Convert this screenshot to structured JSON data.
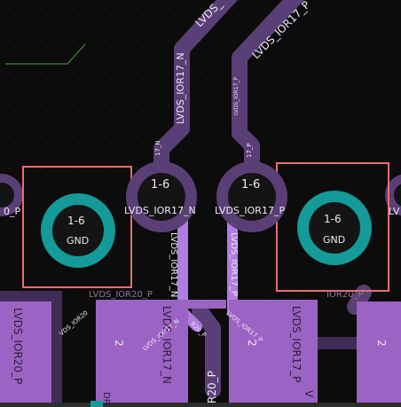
{
  "colors": {
    "background": "#0c0c0c",
    "track_dark": "#5a3f76",
    "track_light": "#b07de0",
    "pad_smd": "#9b63c4",
    "pad_smd_dark": "#412c55",
    "via_ring": "#149a98",
    "via_hole": "#141414",
    "courtyard": "#e96e74",
    "board_edge": "#3f8a35"
  },
  "icons": [
    "via-icon",
    "pad-icon"
  ],
  "pcb": {
    "top_net_left": "LVDS_",
    "top_net_right": "LVDS_IOR17_P",
    "trace_vertical_n": "LVDS_IOR17_N",
    "trace_vertical_p": "LVDS_IOR17_P",
    "small_n": "17_N",
    "small_p": "17_P",
    "via_left": {
      "layers": "1-6",
      "net": "LVDS_IOR17_N"
    },
    "via_right": {
      "layers": "1-6",
      "net": "LVDS_IOR17_P"
    },
    "gnd_left": {
      "layers": "1-6",
      "net": "GND"
    },
    "gnd_right": {
      "layers": "1-6",
      "net": "GND"
    },
    "left_edge_label": "0_P",
    "right_edge_label": "LV",
    "lower_track_n": "LVDS_IOR17_N",
    "lower_track_p": "LVDS_IOR17_P",
    "pad_labels": {
      "pad1_net": "LVDS_IOR20_P",
      "pad2_number": "2",
      "pad2_net": "LVDS_IOR17_N",
      "pad3_number": "2",
      "pad3_net": "LVDS_IOR17_P",
      "pad4_number": "2"
    },
    "ior20_mid": "LVDS_IOR20_P",
    "ior20_right": "IOR20_P",
    "small_ior20_left": "VDS_IOR20",
    "small_ior17n": "LVDS_IOR17_N",
    "small_ior17p": "LVDS_IOR17_P",
    "r20_short": "R20_P",
    "r20p_vertical": "R20_P",
    "v_edge": "V",
    "dp_bottom_left": "DP"
  }
}
